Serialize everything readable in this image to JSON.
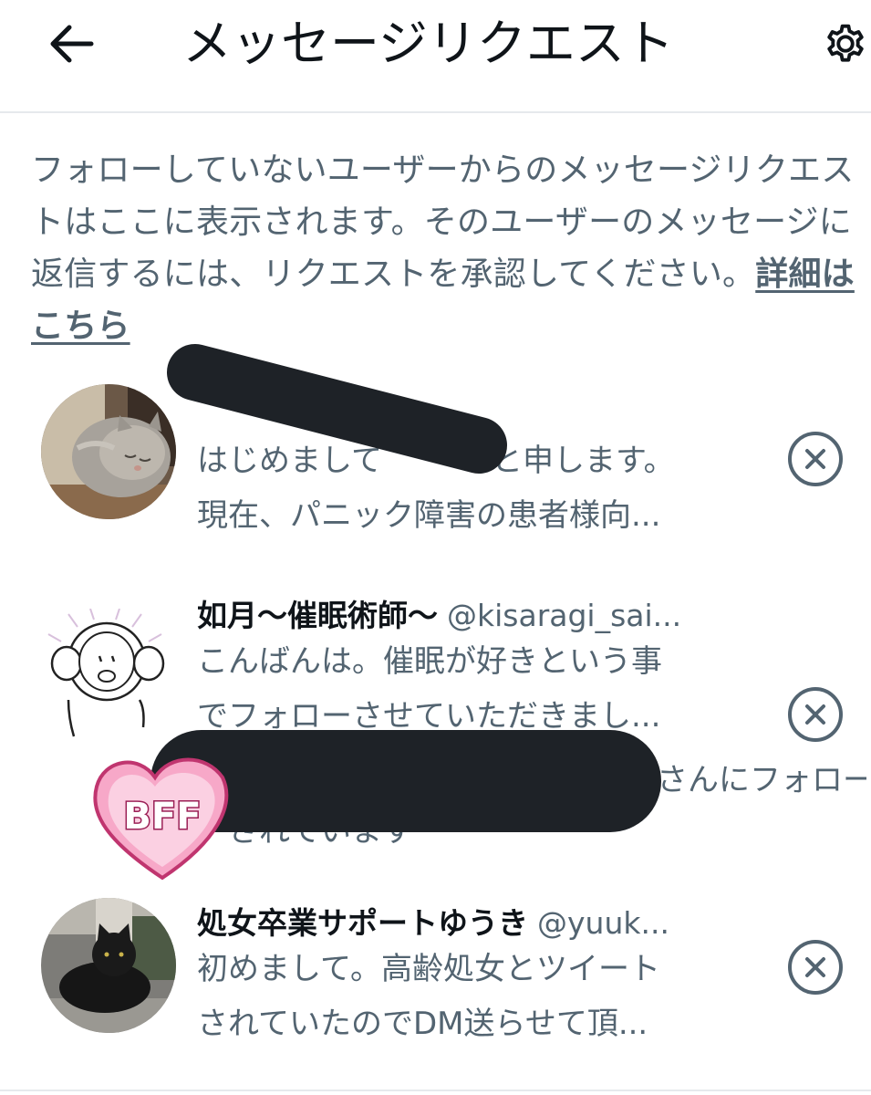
{
  "header": {
    "title": "メッセージリクエスト",
    "back_icon": "arrow-left-icon",
    "settings_icon": "gear-icon"
  },
  "info": {
    "text": "フォローしていないユーザーからのメッセージリクエストはここに表示されます。そのユーザーのメッセージに返信するには、リクエストを承認してください。",
    "link": "詳細はこちら"
  },
  "requests": [
    {
      "name": "",
      "handle": "",
      "message_line1": "はじめまして",
      "message_line1_end": "と申します。",
      "message_line2": "現在、パニック障害の患者様向...",
      "redacted": true
    },
    {
      "name": "如月〜催眠術師〜",
      "handle": "@kisaragi_sai...",
      "message_line1": "こんばんは。催眠が好きという事",
      "message_line2": "でフォローさせていただきまし...",
      "followed_by_suffix": "さんにフォロー",
      "followed_by_line2": "されています"
    },
    {
      "name": "処女卒業サポートゆうき",
      "handle": "@yuuk...",
      "message_line1": "初めまして。高齢処女とツイート",
      "message_line2": "されていたのでDM送らせて頂..."
    }
  ],
  "sticker": {
    "text": "BFF"
  },
  "colors": {
    "text_primary": "#0f1419",
    "text_secondary": "#536471",
    "divider": "#e6e9ec",
    "redaction": "#1e2227",
    "sticker_pink": "#f7a8c8"
  }
}
